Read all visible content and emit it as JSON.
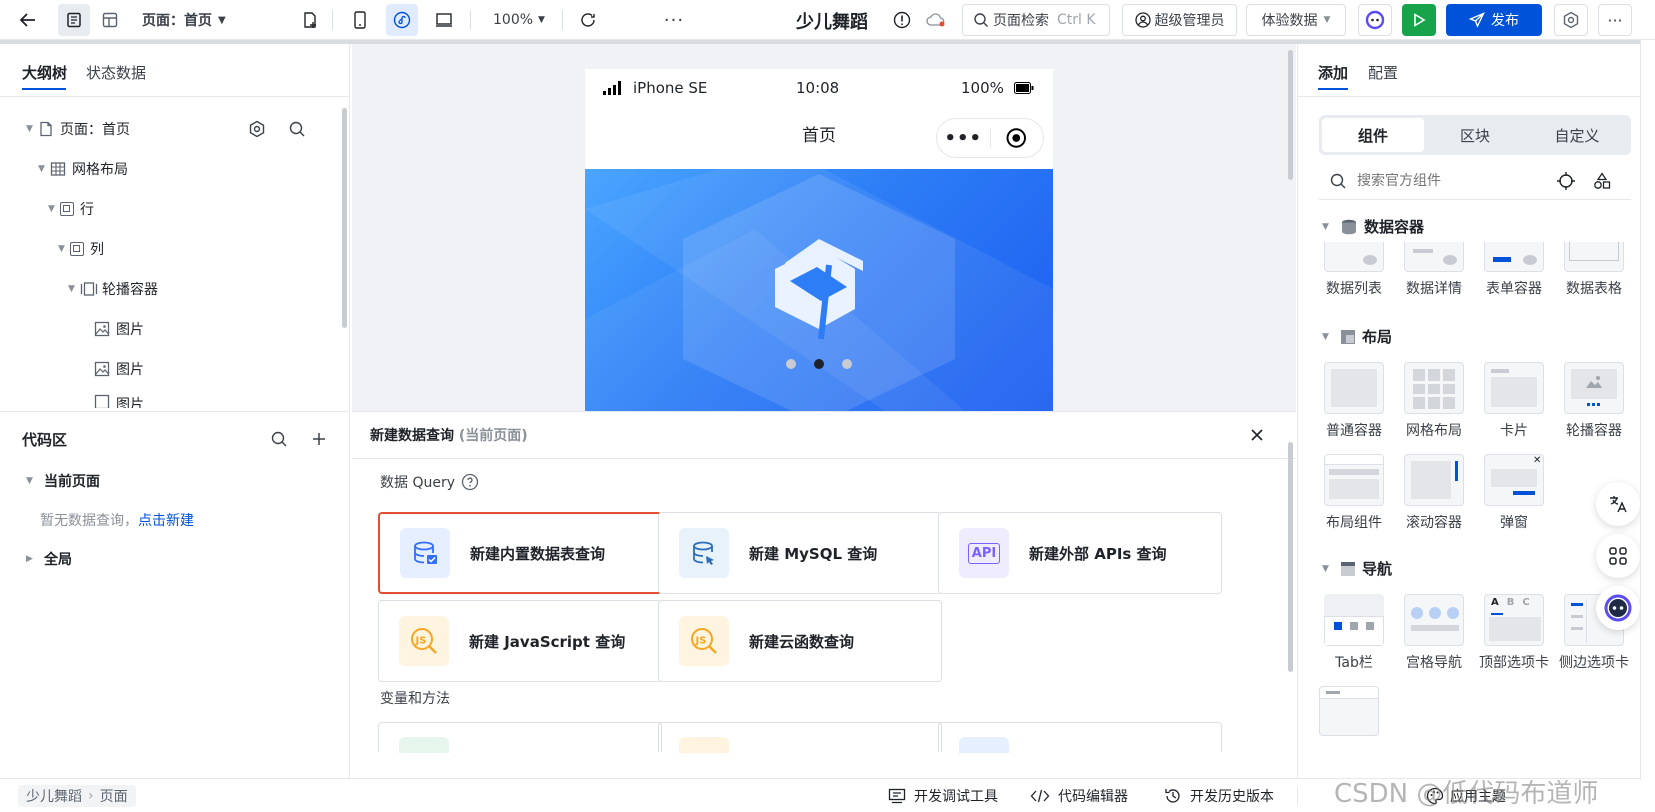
{
  "topbar": {
    "page_selector": "页面：首页",
    "zoom": "100%",
    "app_name": "少儿舞蹈",
    "search_placeholder": "页面检索",
    "search_shortcut": "Ctrl K",
    "user_role": "超级管理员",
    "data_mode": "体验数据",
    "publish_label": "发布"
  },
  "left": {
    "tabs": [
      "大纲树",
      "状态数据"
    ],
    "tree": [
      {
        "label": "页面：首页"
      },
      {
        "label": "网格布局"
      },
      {
        "label": "行"
      },
      {
        "label": "列"
      },
      {
        "label": "轮播容器"
      },
      {
        "label": "图片"
      },
      {
        "label": "图片"
      },
      {
        "label": "图片"
      }
    ],
    "code_area_title": "代码区",
    "current_page": "当前页面",
    "empty_hint": "暂无数据查询，",
    "create_link": "点击新建",
    "global": "全局"
  },
  "phone": {
    "carrier": "iPhone SE",
    "time": "10:08",
    "battery": "100%",
    "title": "首页",
    "carousel_dots": 3,
    "active_dot": 2
  },
  "panel": {
    "title": "新建数据查询",
    "subtitle": "(当前页面)",
    "section_query": "数据 Query",
    "section_vars": "变量和方法",
    "queries": [
      {
        "label": "新建内置数据表查询",
        "icon": "database-table-icon",
        "color": "#3370ff"
      },
      {
        "label": "新建 MySQL 查询",
        "icon": "mysql-icon",
        "color": "#3370ff"
      },
      {
        "label": "新建外部 APIs 查询",
        "icon": "api-icon",
        "color": "#7b61ff"
      },
      {
        "label": "新建 JavaScript 查询",
        "icon": "javascript-icon",
        "color": "#f5a623"
      },
      {
        "label": "新建云函数查询",
        "icon": "cloud-function-icon",
        "color": "#f5a623"
      }
    ]
  },
  "right": {
    "tabs": [
      "添加",
      "配置"
    ],
    "segments": [
      "组件",
      "区块",
      "自定义"
    ],
    "search_placeholder": "搜索官方组件",
    "categories": {
      "data": {
        "title": "数据容器",
        "items": [
          "数据列表",
          "数据详情",
          "表单容器",
          "数据表格"
        ]
      },
      "layout": {
        "title": "布局",
        "items": [
          "普通容器",
          "网格布局",
          "卡片",
          "轮播容器",
          "布局组件",
          "滚动容器",
          "弹窗"
        ]
      },
      "nav": {
        "title": "导航",
        "items": [
          "Tab栏",
          "宫格导航",
          "顶部选项卡",
          "侧边选项卡"
        ]
      }
    }
  },
  "statusbar": {
    "breadcrumb": [
      "少儿舞蹈",
      "页面"
    ],
    "debug_tools": "开发调试工具",
    "code_editor": "代码编辑器",
    "history": "开发历史版本",
    "theme": "应用主题",
    "watermark": "CSDN @低代码布道师"
  },
  "colors": {
    "primary": "#0052d9",
    "green": "#16a34a",
    "danger": "#e34d30"
  }
}
